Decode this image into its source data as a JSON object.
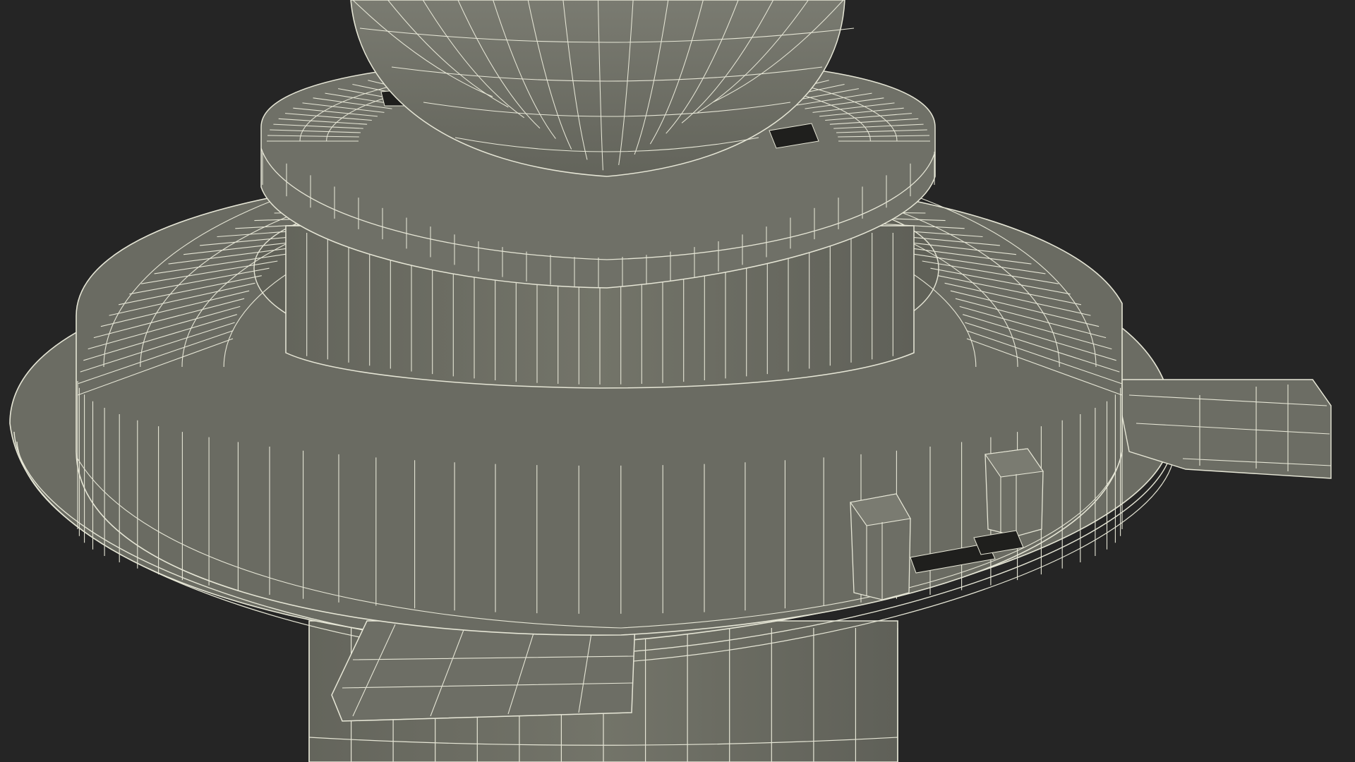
{
  "scene": {
    "subject": "wireframe-3d-render",
    "colors": {
      "background": "#252525",
      "surface": "#6f7067",
      "surface_dark": "#5b5c54",
      "surface_light": "#7c7d73",
      "hole": "#1f1f1d",
      "wire": "#e6e6d6"
    }
  }
}
